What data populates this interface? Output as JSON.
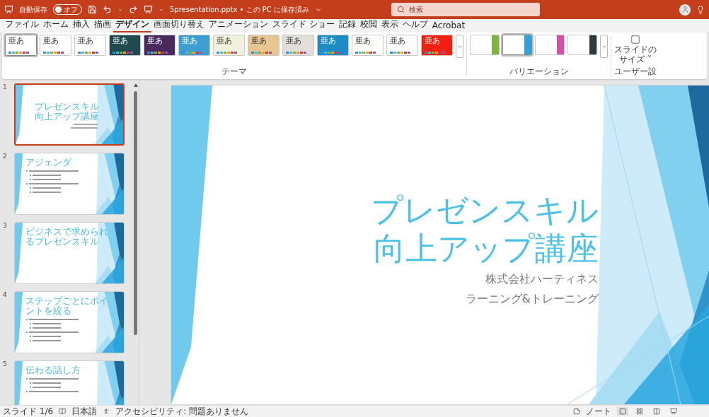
{
  "title_bar": {
    "autosave_label": "自動保存",
    "autosave_toggle": {
      "label": "オフ",
      "on": false
    },
    "file_title": "5presentation.pptx • この PC に保存済み",
    "search": {
      "placeholder": "検索"
    }
  },
  "menu_tabs": [
    {
      "label": "ファイル",
      "selected": false
    },
    {
      "label": "ホーム",
      "selected": false
    },
    {
      "label": "挿入",
      "selected": false
    },
    {
      "label": "描画",
      "selected": false
    },
    {
      "label": "デザイン",
      "selected": true
    },
    {
      "label": "画面切り替え",
      "selected": false
    },
    {
      "label": "アニメーション",
      "selected": false
    },
    {
      "label": "スライド ショー",
      "selected": false
    },
    {
      "label": "記録",
      "selected": false
    },
    {
      "label": "校閲",
      "selected": false
    },
    {
      "label": "表示",
      "selected": false
    },
    {
      "label": "ヘルプ",
      "selected": false
    },
    {
      "label": "Acrobat",
      "selected": false
    }
  ],
  "themes": {
    "group_label": "テーマ",
    "items": [
      {
        "label": "亜あ",
        "color": "#ffffff",
        "selected": true
      },
      {
        "label": "亜あ",
        "color": "#fefefe",
        "selected": false
      },
      {
        "label": "亜あ",
        "color": "#fdfdfd",
        "selected": false
      },
      {
        "label": "亜あ",
        "color": "#1e4a50",
        "selected": false
      },
      {
        "label": "亜あ",
        "color": "#4a2a5c",
        "selected": false
      },
      {
        "label": "亜あ",
        "color": "#3c9fcf",
        "selected": false
      },
      {
        "label": "亜あ",
        "color": "#f2f1de",
        "selected": false
      },
      {
        "label": "亜あ",
        "color": "#e8c692",
        "selected": false
      },
      {
        "label": "亜あ",
        "color": "#e2dfdb",
        "selected": false
      },
      {
        "label": "亜あ",
        "color": "#1d8cc4",
        "selected": false
      },
      {
        "label": "亜あ",
        "color": "#fcfcf8",
        "selected": false
      },
      {
        "label": "亜あ",
        "color": "#fbfbfb",
        "selected": false
      },
      {
        "label": "亜あ",
        "color": "#f22010",
        "selected": false
      }
    ]
  },
  "variations": {
    "group_label": "バリエーション",
    "items": [
      {
        "color": "#7ab83a",
        "selected": false
      },
      {
        "color": "#2aa6dc",
        "selected": true
      },
      {
        "color": "#d64fa8",
        "selected": false
      },
      {
        "color": "#2e3a40",
        "selected": false
      }
    ]
  },
  "slide_size": {
    "label_lines": [
      "スライドの",
      "サイズ ˅"
    ]
  },
  "user_group_label": "ユーザー設",
  "slides": [
    {
      "number": "1",
      "selected": true,
      "kind": "title",
      "title_lines": [
        "プレゼンスキル",
        "向上アップ講座"
      ]
    },
    {
      "number": "2",
      "selected": false,
      "kind": "bullets",
      "title_lines": [
        "アジェンダ"
      ]
    },
    {
      "number": "3",
      "selected": false,
      "kind": "heading",
      "title_lines": [
        "ビジネスで求められるプレゼンスキル"
      ]
    },
    {
      "number": "4",
      "selected": false,
      "kind": "bullets",
      "title_lines": [
        "ステップごとにポイントを絞る"
      ]
    },
    {
      "number": "5",
      "selected": false,
      "kind": "bullets",
      "title_lines": [
        "伝わる話し方"
      ]
    }
  ],
  "current_slide": {
    "title_lines": [
      "プレゼンスキル",
      "向上アップ講座"
    ],
    "subtitle_lines": [
      "株式会社ハーティネス",
      "ラーニング&トレーニング"
    ]
  },
  "status_bar": {
    "slide_count": "スライド 1/6",
    "language": "日本語",
    "accessibility": "アクセシビリティ: 問題ありません",
    "notes": "ノート"
  }
}
